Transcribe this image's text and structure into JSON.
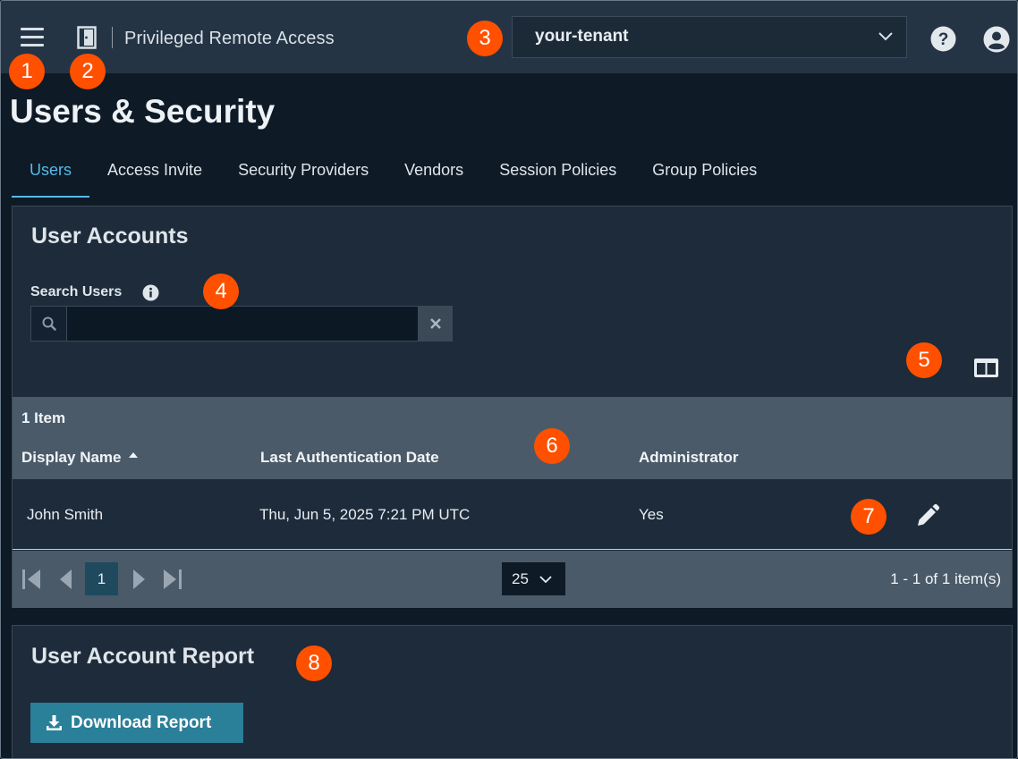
{
  "topbar": {
    "app_title": "Privileged Remote Access",
    "tenant_value": "your-tenant",
    "icons": [
      "hamburger-menu-icon",
      "door-icon",
      "chevron-down-icon",
      "help-icon",
      "user-account-icon"
    ]
  },
  "badges": [
    "1",
    "2",
    "3",
    "4",
    "5",
    "6",
    "7",
    "8"
  ],
  "page": {
    "title": "Users & Security"
  },
  "tabs": [
    {
      "label": "Users",
      "active": true
    },
    {
      "label": "Access Invite",
      "active": false
    },
    {
      "label": "Security Providers",
      "active": false
    },
    {
      "label": "Vendors",
      "active": false
    },
    {
      "label": "Session Policies",
      "active": false
    },
    {
      "label": "Group Policies",
      "active": false
    }
  ],
  "user_accounts": {
    "title": "User Accounts",
    "search": {
      "label": "Search Users",
      "value": "",
      "placeholder": ""
    },
    "item_count": "1 Item",
    "columns": [
      "Display Name",
      "Last Authentication Date",
      "Administrator"
    ],
    "sort": {
      "column": "Display Name",
      "direction": "ascending"
    },
    "rows": [
      {
        "display_name": "John Smith",
        "last_auth": "Thu, Jun 5, 2025 7:21 PM UTC",
        "administrator": "Yes"
      }
    ],
    "pager": {
      "current_page": "1",
      "per_page": "25",
      "info": "1 - 1 of 1 item(s)"
    }
  },
  "report": {
    "title": "User Account Report",
    "download_label": "Download Report"
  },
  "colors": {
    "accent": "#58b9e8",
    "badge": "#ff5000",
    "button": "#2a7f99",
    "topbar": "#243445",
    "background": "#0e1a26"
  }
}
